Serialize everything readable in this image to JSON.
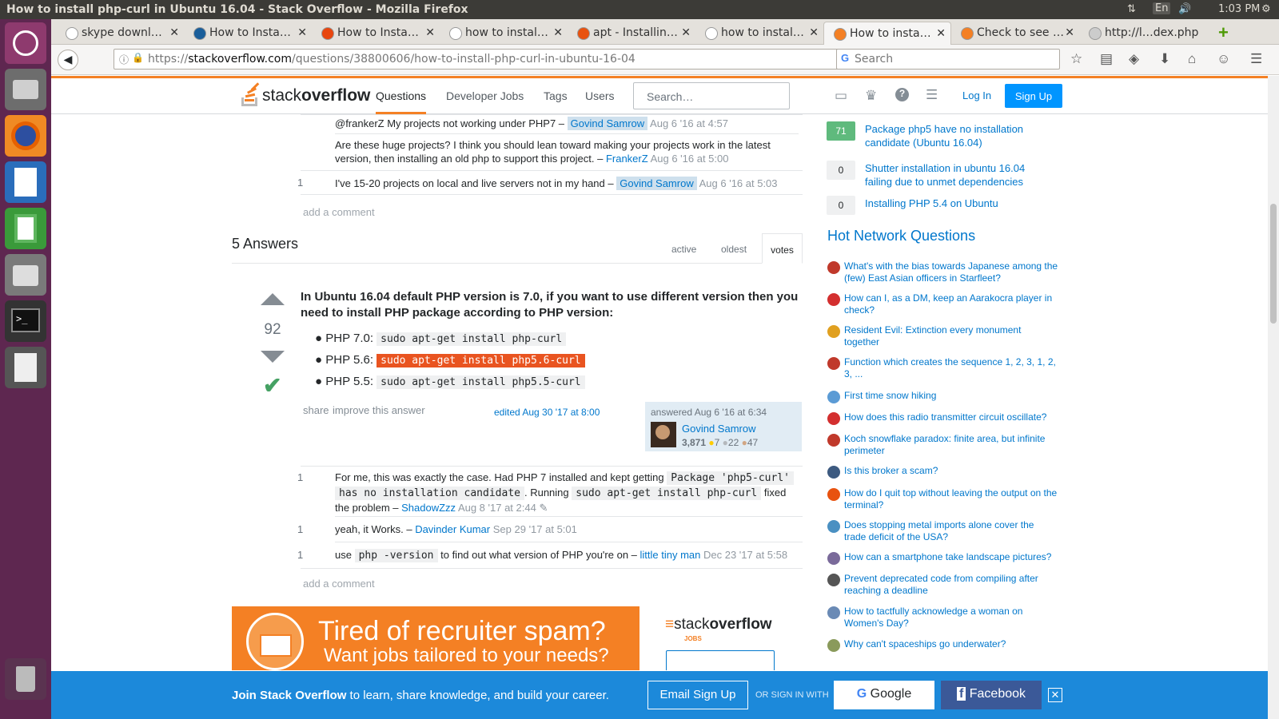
{
  "system": {
    "window_title": "How to install php-curl in Ubuntu 16.04 - Stack Overflow - Mozilla Firefox",
    "lang": "En",
    "time": "1:03 PM"
  },
  "tabs": [
    {
      "label": "skype downl…",
      "color": "#fff"
    },
    {
      "label": "How to Insta…",
      "color": "#1a5e9a"
    },
    {
      "label": "How to Insta…",
      "color": "#e8460f"
    },
    {
      "label": "how to instal…",
      "color": "#fff"
    },
    {
      "label": "apt - Installin…",
      "color": "#e8520f"
    },
    {
      "label": "how to instal…",
      "color": "#fff"
    },
    {
      "label": "How to insta…",
      "color": "#f48024"
    },
    {
      "label": "Check to see …",
      "color": "#f48024"
    },
    {
      "label": "http://l…dex.php",
      "color": "#ccc"
    }
  ],
  "browser": {
    "url_prefix": "https://",
    "url_domain": "stackoverflow.com",
    "url_path": "/questions/38800606/how-to-install-php-curl-in-ubuntu-16-04",
    "search_placeholder": "Search"
  },
  "so": {
    "logo_a": "stack",
    "logo_b": "overflow",
    "nav": [
      "Questions",
      "Developer Jobs",
      "Tags",
      "Users"
    ],
    "search_placeholder": "Search…",
    "login": "Log In",
    "signup": "Sign Up"
  },
  "q_comments": [
    {
      "score": "",
      "text": "@frankerZ My projects not working under PHP7 – ",
      "user": "Govind Samrow",
      "user_hl": true,
      "time": "Aug 6 '16 at 4:57"
    },
    {
      "score": "",
      "text": "Are these huge projects? I think you should lean toward making your projects work in the latest version, then installing an old php to support this project. – ",
      "user": "FrankerZ",
      "user_hl": false,
      "time": "Aug 6 '16 at 5:00"
    },
    {
      "score": "1",
      "text": "I've 15-20 projects on local and live servers not in my hand – ",
      "user": "Govind Samrow",
      "user_hl": true,
      "time": "Aug 6 '16 at 5:03"
    }
  ],
  "add_comment": "add a comment",
  "answers_header": {
    "count": "5 Answers",
    "tabs": [
      "active",
      "oldest",
      "votes"
    ]
  },
  "answer": {
    "votes": "92",
    "intro": "In Ubuntu 16.04 default PHP version is 7.0, if you want to use different version then you need to install PHP package according to PHP version:",
    "items": [
      {
        "label": "PHP 7.0:",
        "cmd": "sudo apt-get install php-curl"
      },
      {
        "label": "PHP 5.6:",
        "cmd": "sudo apt-get install php5.6-curl"
      },
      {
        "label": "PHP 5.5:",
        "cmd": "sudo apt-get install php5.5-curl"
      }
    ],
    "share": "share",
    "improve": "improve this answer",
    "edited": "edited Aug 30 '17 at 8:00",
    "answered": "answered Aug 6 '16 at 6:34",
    "user": "Govind Samrow",
    "rep": "3,871",
    "gold": "7",
    "silver": "22",
    "bronze": "47"
  },
  "a_comments": [
    {
      "score": "1",
      "p1": "For me, this was exactly the case. Had PHP 7 installed and kept getting ",
      "c1": "Package 'php5-curl'",
      "c1b": "has no installation candidate",
      "p2": ". Running ",
      "c2": "sudo apt-get install php-curl",
      "p3": " fixed",
      "p4": "the problem – ",
      "user": "ShadowZzz",
      "time": "Aug 8 '17 at 2:44"
    },
    {
      "score": "1",
      "text": "yeah, it Works. – ",
      "user": "Davinder Kumar",
      "time": "Sep 29 '17 at 5:01"
    },
    {
      "score": "1",
      "p1": "use ",
      "c1": "php -version",
      "p2": " to find out what version of PHP you're on – ",
      "user": "little tiny man",
      "time": "Dec 23 '17 at 5:58"
    }
  ],
  "ad": {
    "line1": "Tired of recruiter spam?",
    "line2": "Want jobs tailored to your needs?",
    "logo_a": "stack",
    "logo_b": "overflow",
    "logo_c": "JOBS"
  },
  "sidebar_linked": [
    {
      "score": "71",
      "text": "Package php5 have no installation candidate (Ubuntu 16.04)",
      "accepted": true
    },
    {
      "score": "0",
      "text": "Shutter installation in ubuntu 16.04 failing due to unmet dependencies",
      "accepted": false
    },
    {
      "score": "0",
      "text": "Installing PHP 5.4 on Ubuntu",
      "accepted": false
    }
  ],
  "hnq_title": "Hot Network Questions",
  "hnq": [
    {
      "text": "What's with the bias towards Japanese among the (few) East Asian officers in Starfleet?",
      "color": "#c0392b"
    },
    {
      "text": "How can I, as a DM, keep an Aarakocra player in check?",
      "color": "#d32f2f"
    },
    {
      "text": "Resident Evil: Extinction every monument together",
      "color": "#e0a020"
    },
    {
      "text": "Function which creates the sequence 1, 2, 3, 1, 2, 3, ...",
      "color": "#c0392b"
    },
    {
      "text": "First time snow hiking",
      "color": "#5b9bd5"
    },
    {
      "text": "How does this radio transmitter circuit oscillate?",
      "color": "#d32f2f"
    },
    {
      "text": "Koch snowflake paradox: finite area, but infinite perimeter",
      "color": "#c0392b"
    },
    {
      "text": "Is this broker a scam?",
      "color": "#3d5a80"
    },
    {
      "text": "How do I quit top without leaving the output on the terminal?",
      "color": "#e8520f"
    },
    {
      "text": "Does stopping metal imports alone cover the trade deficit of the USA?",
      "color": "#4a90c2"
    },
    {
      "text": "How can a smartphone take landscape pictures?",
      "color": "#7a6a9a"
    },
    {
      "text": "Prevent deprecated code from compiling after reaching a deadline",
      "color": "#555"
    },
    {
      "text": "How to tactfully acknowledge a woman on Women's Day?",
      "color": "#6a8ab5"
    },
    {
      "text": "Why can't spaceships go underwater?",
      "color": "#8a9a5b"
    }
  ],
  "join": {
    "bold": "Join Stack Overflow",
    "rest": " to learn, share knowledge, and build your career.",
    "email": "Email Sign Up",
    "or": "OR SIGN IN WITH",
    "google": "Google",
    "facebook": "Facebook"
  }
}
